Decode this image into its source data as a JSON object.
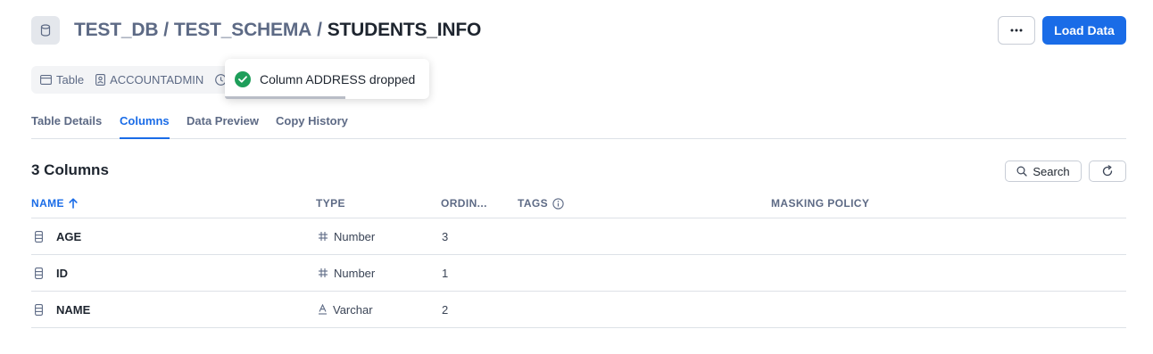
{
  "header": {
    "breadcrumb": [
      "TEST_DB",
      "TEST_SCHEMA"
    ],
    "separator": "/",
    "title": "STUDENTS_INFO",
    "load_button": "Load Data"
  },
  "meta": {
    "kind": "Table",
    "owner": "ACCOUNTADMIN"
  },
  "toast": {
    "message": "Column ADDRESS dropped",
    "status": "success",
    "progress": 0.59
  },
  "tabs": [
    {
      "label": "Table Details",
      "active": false
    },
    {
      "label": "Columns",
      "active": true
    },
    {
      "label": "Data Preview",
      "active": false
    },
    {
      "label": "Copy History",
      "active": false
    }
  ],
  "columns_panel": {
    "heading": "3 Columns",
    "search_label": "Search",
    "headers": {
      "name": "NAME",
      "type": "TYPE",
      "ordinal": "ORDIN...",
      "tags": "TAGS",
      "masking": "MASKING POLICY"
    },
    "sort": {
      "column": "name",
      "direction": "ascending"
    },
    "rows": [
      {
        "name": "AGE",
        "type": "Number",
        "type_icon": "hash-icon",
        "ordinal": "3"
      },
      {
        "name": "ID",
        "type": "Number",
        "type_icon": "hash-icon",
        "ordinal": "1"
      },
      {
        "name": "NAME",
        "type": "Varchar",
        "type_icon": "text-type-icon",
        "ordinal": "2"
      }
    ]
  },
  "colors": {
    "accent": "#1a6ce7",
    "success": "#1e9e5a",
    "muted_text": "#5d6a85"
  }
}
